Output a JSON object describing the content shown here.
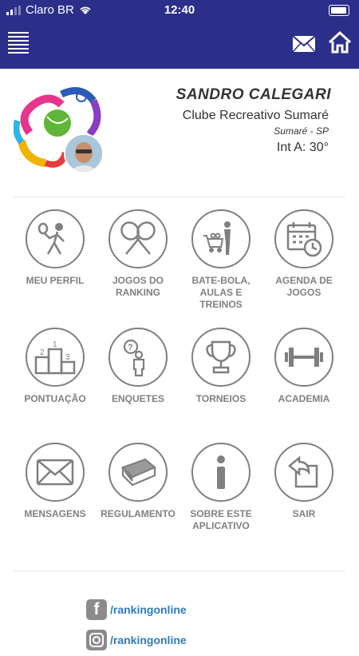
{
  "status_bar": {
    "carrier": "Claro BR",
    "time": "12:40"
  },
  "header": {
    "menu_icon": "hamburger-icon",
    "mail_icon": "envelope-icon",
    "home_icon": "house-icon",
    "color": "#2b2f8a"
  },
  "profile": {
    "name": "SANDRO CALEGARI",
    "club": "Clube Recreativo Sumaré",
    "city": "Sumaré - SP",
    "rating": "Int A: 30°"
  },
  "menu": [
    {
      "label": "MEU PERFIL",
      "icon": "tennis-player-icon"
    },
    {
      "label": "JOGOS DO RANKING",
      "icon": "crossed-rackets-icon"
    },
    {
      "label": "BATE-BOLA, AULAS E TREINOS",
      "icon": "ball-cart-trainer-icon"
    },
    {
      "label": "AGENDA DE JOGOS",
      "icon": "calendar-clock-icon"
    },
    {
      "label": "PONTUAÇÃO",
      "icon": "podium-icon"
    },
    {
      "label": "ENQUETES",
      "icon": "person-question-icon"
    },
    {
      "label": "TORNEIOS",
      "icon": "trophy-icon"
    },
    {
      "label": "ACADEMIA",
      "icon": "dumbbell-icon"
    },
    {
      "label": "MENSAGENS",
      "icon": "envelope-icon"
    },
    {
      "label": "REGULAMENTO",
      "icon": "book-icon"
    },
    {
      "label": "SOBRE ESTE APLICATIVO",
      "icon": "info-icon"
    },
    {
      "label": "SAIR",
      "icon": "exit-icon"
    }
  ],
  "social": [
    {
      "handle": "/rankingonline",
      "icon": "facebook-icon",
      "glyph": "f"
    },
    {
      "handle": "/rankingonline",
      "icon": "instagram-icon",
      "glyph": ""
    }
  ]
}
